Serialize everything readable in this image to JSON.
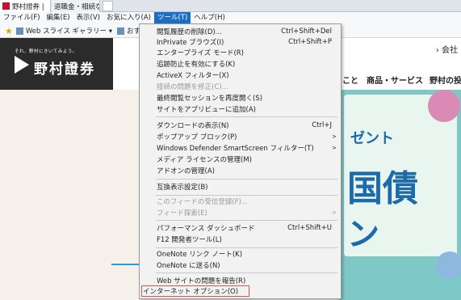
{
  "tabs": [
    {
      "label": "野村證券 |"
    },
    {
      "label": "退職金・相続など..."
    }
  ],
  "menubar": [
    {
      "label": "ファイル(F)"
    },
    {
      "label": "編集(E)"
    },
    {
      "label": "表示(V)"
    },
    {
      "label": "お気に入り(A)"
    },
    {
      "label": "ツール(T)"
    },
    {
      "label": "ヘルプ(H)"
    }
  ],
  "favorites_bar": {
    "items": [
      {
        "label": "Web スライス ギャラリー ▾"
      },
      {
        "label": "おすすめサイ"
      }
    ]
  },
  "site": {
    "logo_tagline": "それ、野村にきいてみよう。",
    "logo_text": "野村證券",
    "company_link": "› 会社",
    "nav": [
      "こと",
      "商品・サービス",
      "野村の投"
    ]
  },
  "hero": {
    "line1": "ゼント",
    "line2": "国債",
    "line3": "ン"
  },
  "tools_menu": {
    "items": [
      {
        "label": "閲覧履歴の削除(D)...",
        "shortcut": "Ctrl+Shift+Del"
      },
      {
        "label": "InPrivate ブラウズ(I)",
        "shortcut": "Ctrl+Shift+P"
      },
      {
        "label": "エンタープライズ モード(R)"
      },
      {
        "label": "追跡防止を有効にする(K)"
      },
      {
        "label": "ActiveX フィルター(X)"
      },
      {
        "label": "接続の問題を修正(C)...",
        "disabled": true
      },
      {
        "label": "最終閲覧セッションを再度開く(S)"
      },
      {
        "label": "サイトをアプリビューに追加(A)"
      },
      {
        "label": "ダウンロードの表示(N)",
        "shortcut": "Ctrl+J"
      },
      {
        "label": "ポップアップ ブロック(P)",
        "submenu": true
      },
      {
        "label": "Windows Defender SmartScreen フィルター(T)",
        "submenu": true
      },
      {
        "label": "メディア ライセンスの管理(M)"
      },
      {
        "label": "アドオンの管理(A)"
      },
      {
        "label": "互換表示設定(B)"
      },
      {
        "label": "このフィードの受信登録(F)...",
        "disabled": true
      },
      {
        "label": "フィード探索(E)",
        "disabled": true,
        "submenu": true
      },
      {
        "label": "パフォーマンス ダッシュボード",
        "shortcut": "Ctrl+Shift+U"
      },
      {
        "label": "F12 開発者ツール(L)"
      },
      {
        "label": "OneNote リンク ノート(K)"
      },
      {
        "label": "OneNote に送る(N)"
      },
      {
        "label": "Web サイトの問題を報告(R)"
      },
      {
        "label": "インターネット オプション(O)",
        "highlighted": true
      }
    ]
  }
}
